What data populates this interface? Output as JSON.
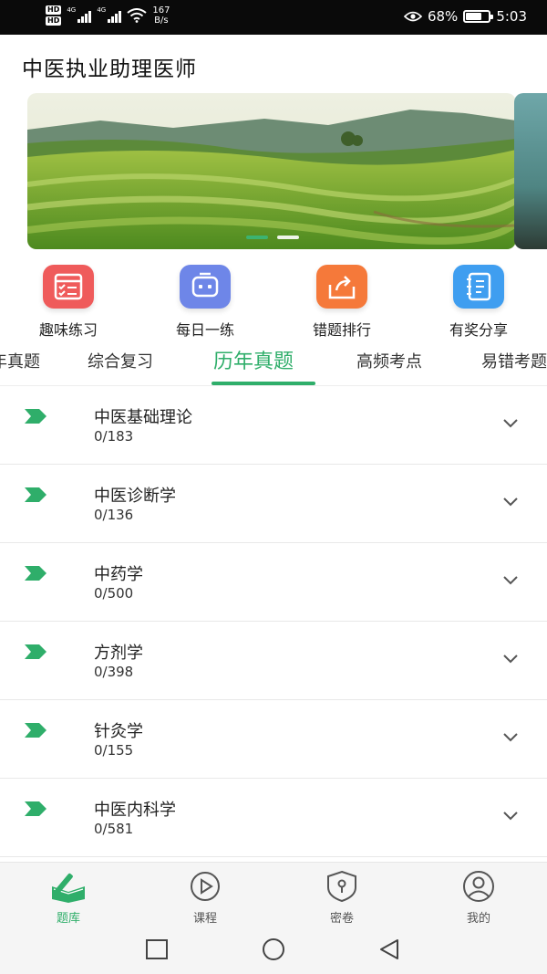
{
  "status_bar": {
    "hd1": "HD",
    "hd2": "HD",
    "net1": "4G",
    "net2": "4G",
    "speed_value": "167",
    "speed_unit": "B/s",
    "battery_percent": "68%",
    "battery_level": 0.68,
    "time": "5:03"
  },
  "header": {
    "title": "中医执业助理医师"
  },
  "banner": {
    "slide_count": 2,
    "active_slide": 0
  },
  "quick_actions": [
    {
      "label": "趣味练习",
      "icon": "calendar-checklist-icon",
      "color": "#ef5b5b"
    },
    {
      "label": "每日一练",
      "icon": "robot-face-icon",
      "color": "#6e86e8"
    },
    {
      "label": "错题排行",
      "icon": "share-box-icon",
      "color": "#f5793a"
    },
    {
      "label": "有奖分享",
      "icon": "notebook-icon",
      "color": "#3f9ef0"
    }
  ],
  "tabs": [
    {
      "label": "年真题",
      "active": false
    },
    {
      "label": "综合复习",
      "active": false
    },
    {
      "label": "历年真题",
      "active": true
    },
    {
      "label": "高频考点",
      "active": false
    },
    {
      "label": "易错考题",
      "active": false
    }
  ],
  "subjects": [
    {
      "title": "中医基础理论",
      "progress": "0/183"
    },
    {
      "title": "中医诊断学",
      "progress": "0/136"
    },
    {
      "title": "中药学",
      "progress": "0/500"
    },
    {
      "title": "方剂学",
      "progress": "0/398"
    },
    {
      "title": "针灸学",
      "progress": "0/155"
    },
    {
      "title": "中医内科学",
      "progress": "0/581"
    }
  ],
  "bottom_nav": [
    {
      "label": "题库",
      "icon": "book-pen-icon",
      "active": true
    },
    {
      "label": "课程",
      "icon": "play-circle-icon",
      "active": false
    },
    {
      "label": "密卷",
      "icon": "shield-lock-icon",
      "active": false
    },
    {
      "label": "我的",
      "icon": "user-circle-icon",
      "active": false
    }
  ],
  "colors": {
    "accent": "#2fae6a",
    "status_bar": "#0a0a0a",
    "nav_bg": "#f5f5f5"
  }
}
